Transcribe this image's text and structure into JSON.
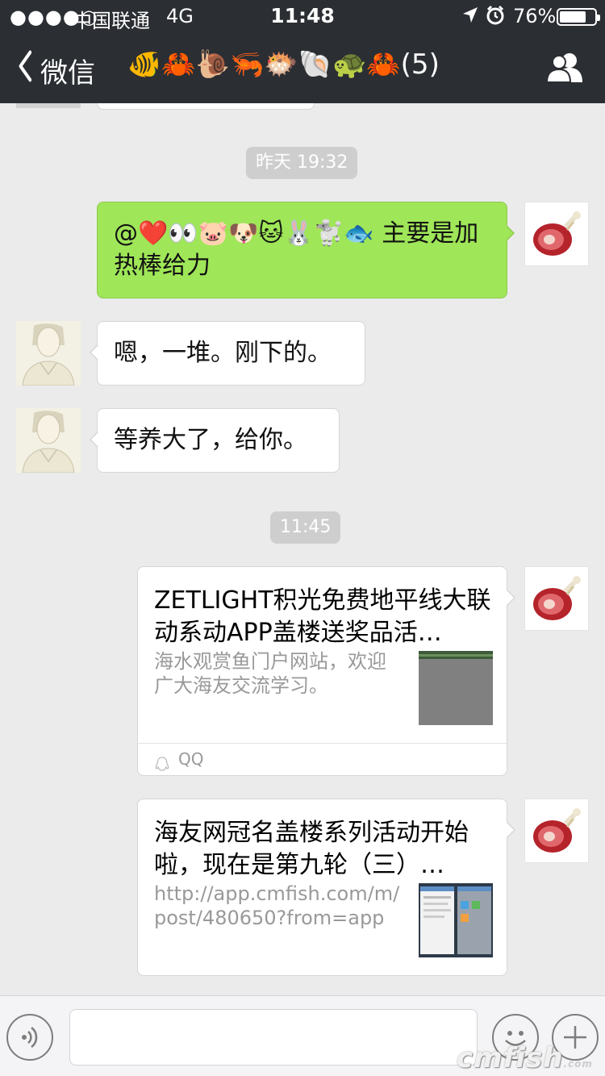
{
  "status_bar": {
    "signal": "●●●●○",
    "carrier": "中国联通",
    "network": "4G",
    "time": "11:48",
    "battery_pct": "76%",
    "battery_level": 0.76
  },
  "nav": {
    "back_label": "微信",
    "title": "🐠🦀🐌🦐🐡🐚🐢🦀(5)",
    "people_icon": "group-members-icon"
  },
  "messages": {
    "ts1": "昨天 19:32",
    "m1": "@❤️👀🐷🐶🐱🐰🐩🐟 主要是加热棒给力",
    "m2": "嗯，一堆。刚下的。",
    "m3": "等养大了，给你。",
    "ts2": "11:45",
    "card1": {
      "title": "ZETLIGHT积光免费地平线大联动系动APP盖楼送奖品活…",
      "desc": "海水观赏鱼门户网站，欢迎广大海友交流学习。",
      "source": "QQ"
    },
    "card2": {
      "title": "海友网冠名盖楼系列活动开始啦，现在是第九轮（三）…",
      "desc": "http://app.cmfish.com/m/post/480650?from=app"
    }
  },
  "watermark": {
    "brand": "cmfish",
    "sub": ".com"
  },
  "colors": {
    "nav_bg": "#2b2e33",
    "chat_bg": "#ebebeb",
    "sent_bubble": "#9fe658",
    "received_bubble": "#ffffff"
  }
}
